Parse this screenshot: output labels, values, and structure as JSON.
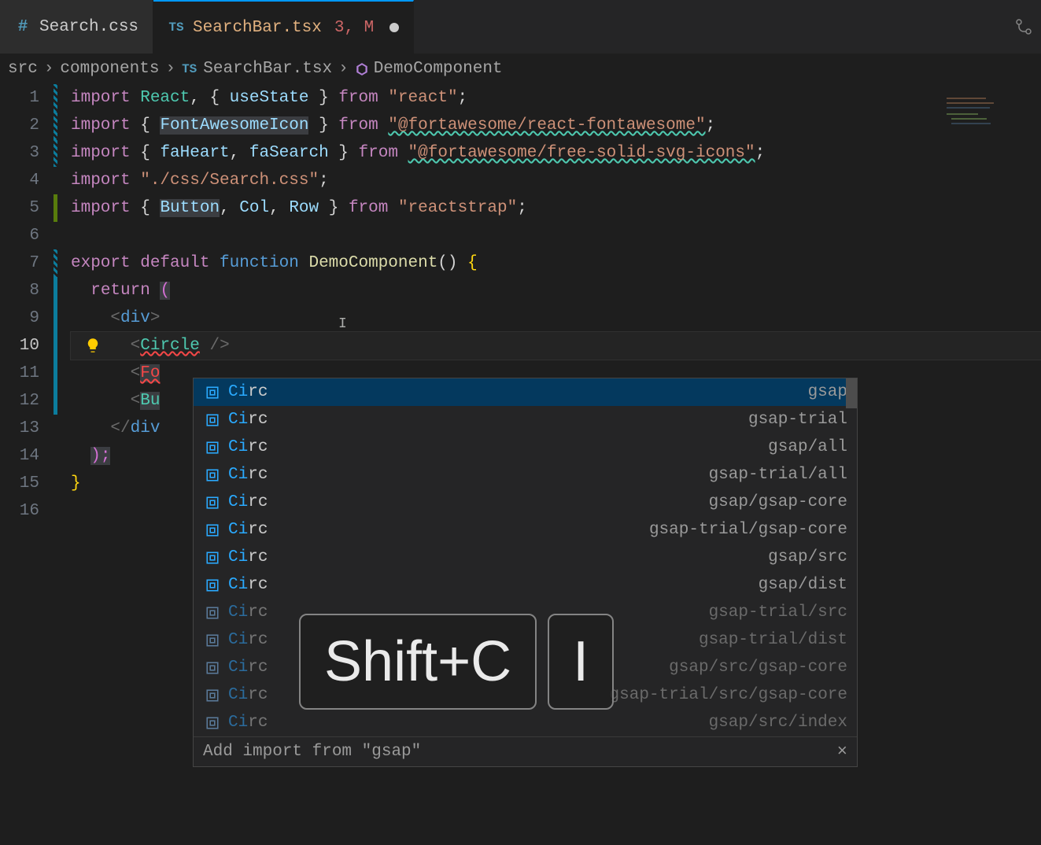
{
  "tabs": [
    {
      "label": "Search.css",
      "icon": "#",
      "active": false
    },
    {
      "label": "SearchBar.tsx",
      "icon": "TS",
      "meta": "3, M",
      "dirty": true,
      "active": true
    }
  ],
  "breadcrumbs": {
    "parts": [
      "src",
      "components"
    ],
    "file_icon": "TS",
    "file": "SearchBar.tsx",
    "symbol": "DemoComponent"
  },
  "gutter": [
    "1",
    "2",
    "3",
    "4",
    "5",
    "6",
    "7",
    "8",
    "9",
    "10",
    "11",
    "12",
    "13",
    "14",
    "15",
    "16"
  ],
  "active_line_index": 9,
  "code_lines": {
    "l1": {
      "import": "import ",
      "name": "React",
      "comma": ", ",
      "lb": "{ ",
      "hook": "useState",
      "rb": " } ",
      "from": "from ",
      "str": "\"react\"",
      "semi": ";"
    },
    "l2": {
      "import": "import ",
      "lb": "{ ",
      "name": "FontAwesomeIcon",
      "rb": " } ",
      "from": "from ",
      "str": "\"@fortawesome/react-fontawesome\"",
      "semi": ";"
    },
    "l3": {
      "import": "import ",
      "lb": "{ ",
      "n1": "faHeart",
      "c": ", ",
      "n2": "faSearch",
      "rb": " } ",
      "from": "from ",
      "str": "\"@fortawesome/free-solid-svg-icons\"",
      "semi": ";"
    },
    "l4": {
      "import": "import ",
      "str": "\"./css/Search.css\"",
      "semi": ";"
    },
    "l5": {
      "import": "import ",
      "lb": "{ ",
      "n1": "Button",
      "c1": ", ",
      "n2": "Col",
      "c2": ", ",
      "n3": "Row",
      "rb": " } ",
      "from": "from ",
      "str": "\"reactstrap\"",
      "semi": ";"
    },
    "l7": {
      "export": "export ",
      "default": "default ",
      "function": "function ",
      "name": "DemoComponent",
      "paren": "()",
      "brace": " {"
    },
    "l8": {
      "return": "return ",
      "paren": "("
    },
    "l9": {
      "open": "<",
      "tag": "div",
      "close": ">"
    },
    "l10": {
      "open": "<",
      "tag": "Circle",
      "close": " />"
    },
    "l11": {
      "open": "<",
      "tag": "Fo"
    },
    "l12": {
      "open": "<",
      "tag": "Bu"
    },
    "l13": {
      "open": "</",
      "tag": "div"
    },
    "l14": {
      "close": ");"
    },
    "l15": {
      "brace": "}"
    }
  },
  "suggestions": {
    "items": [
      {
        "label": "Circ",
        "source": "gsap",
        "selected": true,
        "dim": false
      },
      {
        "label": "Circ",
        "source": "gsap-trial",
        "dim": false
      },
      {
        "label": "Circ",
        "source": "gsap/all",
        "dim": false
      },
      {
        "label": "Circ",
        "source": "gsap-trial/all",
        "dim": false
      },
      {
        "label": "Circ",
        "source": "gsap/gsap-core",
        "dim": false
      },
      {
        "label": "Circ",
        "source": "gsap-trial/gsap-core",
        "dim": false
      },
      {
        "label": "Circ",
        "source": "gsap/src",
        "dim": false
      },
      {
        "label": "Circ",
        "source": "gsap/dist",
        "dim": false
      },
      {
        "label": "Circ",
        "source": "gsap-trial/src",
        "dim": true
      },
      {
        "label": "Circ",
        "source": "gsap-trial/dist",
        "dim": true
      },
      {
        "label": "Circ",
        "source": "gsap/src/gsap-core",
        "dim": true
      },
      {
        "label": "Circ",
        "source": "gsap-trial/src/gsap-core",
        "dim": true
      },
      {
        "label": "Circ",
        "source": "gsap/src/index",
        "dim": true
      }
    ],
    "match_prefix": "Ci",
    "match_suffix": "rc",
    "footer": "Add import from \"gsap\""
  },
  "key_overlay": {
    "k1": "Shift+C",
    "k2": "I"
  },
  "colors": {
    "accent": "#0098ff",
    "keyword": "#c586c0",
    "type": "#4ec9b0",
    "string": "#ce9178",
    "function": "#dcdcaa"
  }
}
